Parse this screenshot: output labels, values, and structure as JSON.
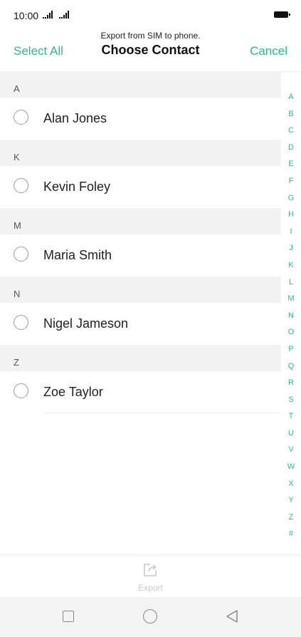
{
  "status": {
    "time": "10:00"
  },
  "header": {
    "subtitle": "Export from SIM to phone.",
    "title": "Choose Contact",
    "select_all_label": "Select All",
    "cancel_label": "Cancel"
  },
  "sections": [
    {
      "letter": "A",
      "contacts": [
        {
          "name": "Alan Jones",
          "selected": false
        }
      ]
    },
    {
      "letter": "K",
      "contacts": [
        {
          "name": "Kevin Foley",
          "selected": false
        }
      ]
    },
    {
      "letter": "M",
      "contacts": [
        {
          "name": "Maria Smith",
          "selected": false
        }
      ]
    },
    {
      "letter": "N",
      "contacts": [
        {
          "name": "Nigel Jameson",
          "selected": false
        }
      ]
    },
    {
      "letter": "Z",
      "contacts": [
        {
          "name": "Zoe Taylor",
          "selected": false
        }
      ]
    }
  ],
  "index_letters": [
    "A",
    "B",
    "C",
    "D",
    "E",
    "F",
    "G",
    "H",
    "I",
    "J",
    "K",
    "L",
    "M",
    "N",
    "O",
    "P",
    "Q",
    "R",
    "S",
    "T",
    "U",
    "V",
    "W",
    "X",
    "Y",
    "Z",
    "#"
  ],
  "export": {
    "label": "Export",
    "icon": "export-icon",
    "enabled": false
  },
  "navbar": {
    "icons": [
      "recent-apps-icon",
      "home-icon",
      "back-icon"
    ]
  },
  "colors": {
    "accent": "#2fb983",
    "section_bg": "#f2f2f2",
    "disabled": "#c8c8c8"
  }
}
